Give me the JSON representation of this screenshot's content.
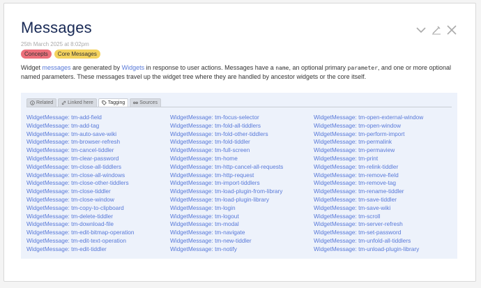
{
  "tiddler": {
    "title": "Messages",
    "subtitle": "25th March 2025 at 8:02pm",
    "tags": [
      "Concepts",
      "Core Messages"
    ],
    "body": {
      "p1": "Widget ",
      "link_messages": "messages",
      "p2": " are generated by ",
      "link_widgets": "Widgets",
      "p3": " in response to user actions. Messages have a ",
      "code_name": "name",
      "p4": ", an optional primary ",
      "code_param": "parameter",
      "p5": ", and one or more optional named parameters. These messages travel up the widget tree where they are handled by ancestor widgets or the core itself."
    },
    "controls": [
      "chevron-down-icon",
      "edit-icon",
      "close-icon"
    ]
  },
  "info": {
    "tabs": [
      {
        "label": "Related",
        "icon": "info-icon"
      },
      {
        "label": "Linked here",
        "icon": "link-icon"
      },
      {
        "label": "Tagging",
        "icon": "tag-icon"
      },
      {
        "label": "Sources",
        "icon": "sources-icon"
      }
    ],
    "active_tab": "Tagging",
    "columns": [
      [
        "WidgetMessage: tm-add-field",
        "WidgetMessage: tm-add-tag",
        "WidgetMessage: tm-auto-save-wiki",
        "WidgetMessage: tm-browser-refresh",
        "WidgetMessage: tm-cancel-tiddler",
        "WidgetMessage: tm-clear-password",
        "WidgetMessage: tm-close-all-tiddlers",
        "WidgetMessage: tm-close-all-windows",
        "WidgetMessage: tm-close-other-tiddlers",
        "WidgetMessage: tm-close-tiddler",
        "WidgetMessage: tm-close-window",
        "WidgetMessage: tm-copy-to-clipboard",
        "WidgetMessage: tm-delete-tiddler",
        "WidgetMessage: tm-download-file",
        "WidgetMessage: tm-edit-bitmap-operation",
        "WidgetMessage: tm-edit-text-operation",
        "WidgetMessage: tm-edit-tiddler"
      ],
      [
        "WidgetMessage: tm-focus-selector",
        "WidgetMessage: tm-fold-all-tiddlers",
        "WidgetMessage: tm-fold-other-tiddlers",
        "WidgetMessage: tm-fold-tiddler",
        "WidgetMessage: tm-full-screen",
        "WidgetMessage: tm-home",
        "WidgetMessage: tm-http-cancel-all-requests",
        "WidgetMessage: tm-http-request",
        "WidgetMessage: tm-import-tiddlers",
        "WidgetMessage: tm-load-plugin-from-library",
        "WidgetMessage: tm-load-plugin-library",
        "WidgetMessage: tm-login",
        "WidgetMessage: tm-logout",
        "WidgetMessage: tm-modal",
        "WidgetMessage: tm-navigate",
        "WidgetMessage: tm-new-tiddler",
        "WidgetMessage: tm-notify"
      ],
      [
        "WidgetMessage: tm-open-external-window",
        "WidgetMessage: tm-open-window",
        "WidgetMessage: tm-perform-import",
        "WidgetMessage: tm-permalink",
        "WidgetMessage: tm-permaview",
        "WidgetMessage: tm-print",
        "WidgetMessage: tm-relink-tiddler",
        "WidgetMessage: tm-remove-field",
        "WidgetMessage: tm-remove-tag",
        "WidgetMessage: tm-rename-tiddler",
        "WidgetMessage: tm-save-tiddler",
        "WidgetMessage: tm-save-wiki",
        "WidgetMessage: tm-scroll",
        "WidgetMessage: tm-server-refresh",
        "WidgetMessage: tm-set-password",
        "WidgetMessage: tm-unfold-all-tiddlers",
        "WidgetMessage: tm-unload-plugin-library"
      ]
    ]
  }
}
